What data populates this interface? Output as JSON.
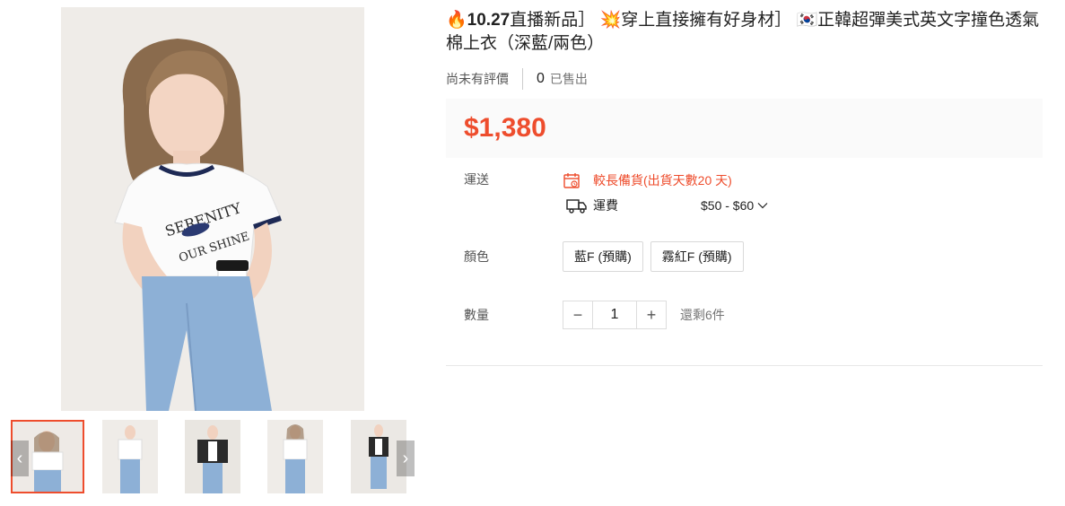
{
  "product": {
    "title_prefix_icon": "fire-emoji",
    "title_bold": "10.27",
    "title_part1": "直播新品］",
    "title_icon2": "collision-emoji",
    "title_part2": "穿上直接擁有好身材］",
    "title_icon3": "korea-flag-emoji",
    "title_part3": "正韓超彈美式英文字撞色透氣棉上衣（深藍/兩色）",
    "rating_text": "尚未有評價",
    "sold_count": "0",
    "sold_label": "已售出",
    "price": "$1,380"
  },
  "shipping": {
    "label": "運送",
    "lead_time": "較長備貨(出貨天數20 天)",
    "fee_label": "運費",
    "fee_value": "$50 - $60",
    "calendar_icon": "calendar-icon",
    "truck_icon": "truck-icon",
    "chevron_icon": "chevron-down-icon"
  },
  "variants": {
    "label": "顏色",
    "options": [
      "藍F (預購)",
      "霧紅F (預購)"
    ]
  },
  "quantity": {
    "label": "數量",
    "value": "1",
    "minus": "−",
    "plus": "+",
    "stock": "還剩6件"
  },
  "gallery": {
    "prev": "‹",
    "next": "›",
    "thumbnail_count": 5,
    "active_index": 0
  },
  "colors": {
    "accent": "#ee4d2d",
    "price_bg": "#fafafa"
  }
}
